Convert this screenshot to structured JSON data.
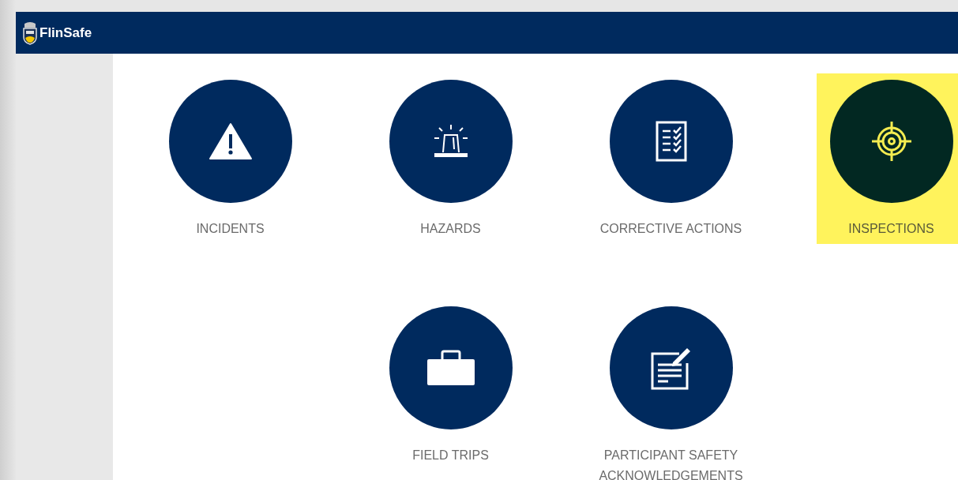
{
  "header": {
    "app_name": "FlinSafe"
  },
  "tiles": [
    {
      "label": "INCIDENTS",
      "kind": "warning",
      "selected": false
    },
    {
      "label": "HAZARDS",
      "kind": "beacon",
      "selected": false
    },
    {
      "label": "CORRECTIVE ACTIONS",
      "kind": "checklist",
      "selected": false
    },
    {
      "label": "INSPECTIONS",
      "kind": "target",
      "selected": true
    },
    {
      "label": "FIELD TRIPS",
      "kind": "briefcase",
      "selected": false
    },
    {
      "label": "PARTICIPANT SAFETY ACKNOWLEDGEMENTS",
      "kind": "form",
      "selected": false
    }
  ]
}
